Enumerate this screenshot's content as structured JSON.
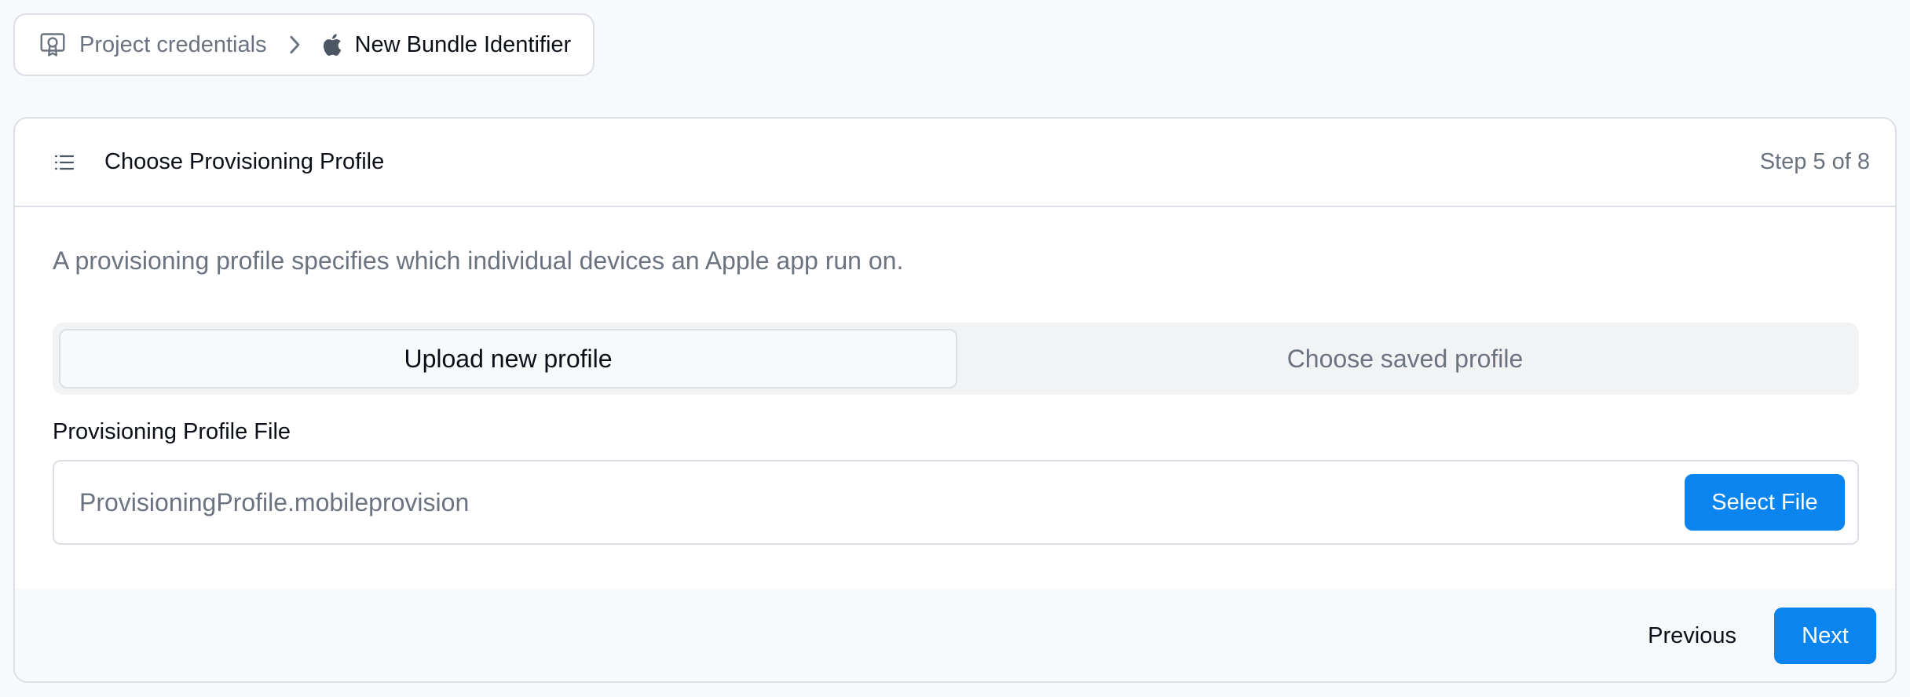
{
  "breadcrumb": {
    "items": [
      {
        "label": "Project credentials",
        "icon": "certificate-icon"
      },
      {
        "label": "New Bundle Identifier",
        "icon": "apple-icon"
      }
    ],
    "separator_icon": "chevron-right-icon"
  },
  "card": {
    "header_icon": "list-icon",
    "title": "Choose Provisioning Profile",
    "step": "Step 5 of 8",
    "description": "A provisioning profile specifies which individual devices an Apple app run on.",
    "tabs": [
      {
        "label": "Upload new profile",
        "selected": true
      },
      {
        "label": "Choose saved profile",
        "selected": false
      }
    ],
    "file_label": "Provisioning Profile File",
    "file_value": "ProvisioningProfile.mobileprovision",
    "select_button": "Select File"
  },
  "footer": {
    "previous_label": "Previous",
    "next_label": "Next"
  },
  "colors": {
    "accent": "#0a84ef",
    "muted_text": "#6b7280",
    "border": "#dcdfe5",
    "background": "#f8f9fb"
  }
}
